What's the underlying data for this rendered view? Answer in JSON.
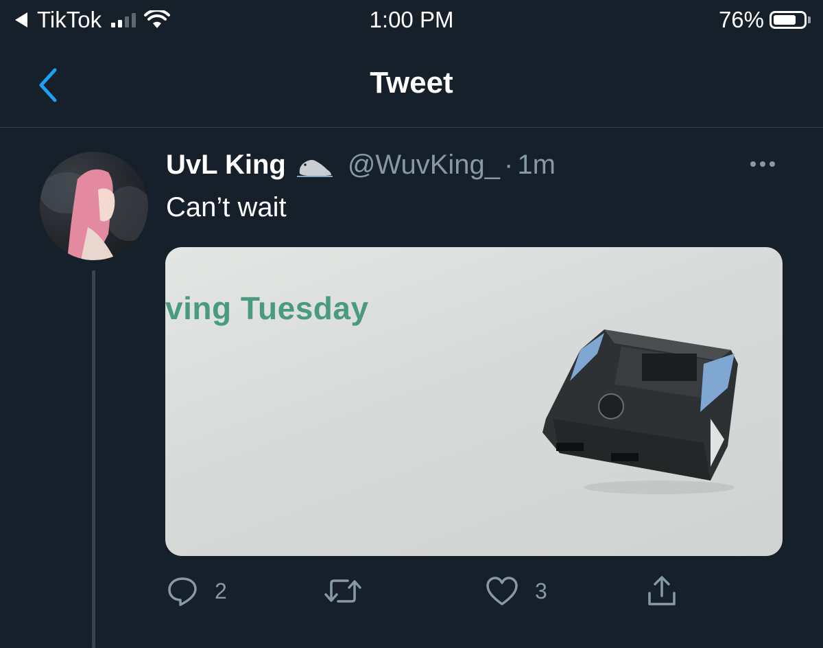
{
  "status_bar": {
    "back_app": "TikTok",
    "time": "1:00 PM",
    "battery_percent": "76%",
    "battery_level": 0.76
  },
  "nav": {
    "title": "Tweet",
    "back_icon": "chevron-left-icon"
  },
  "tweet": {
    "display_name": "UvL King",
    "name_emoji": "seal-emoji",
    "handle": "@WuvKing_",
    "separator": "·",
    "time": "1m",
    "text": "Can’t wait",
    "media": {
      "visible_text": "ving Tuesday",
      "subject": "controller-adapter-device"
    },
    "actions": {
      "reply_count": "2",
      "retweet_count": "",
      "like_count": "3"
    }
  },
  "colors": {
    "background": "#15202b",
    "accent": "#1da1f2",
    "secondary_text": "#8899a6",
    "divider": "#38444d"
  }
}
